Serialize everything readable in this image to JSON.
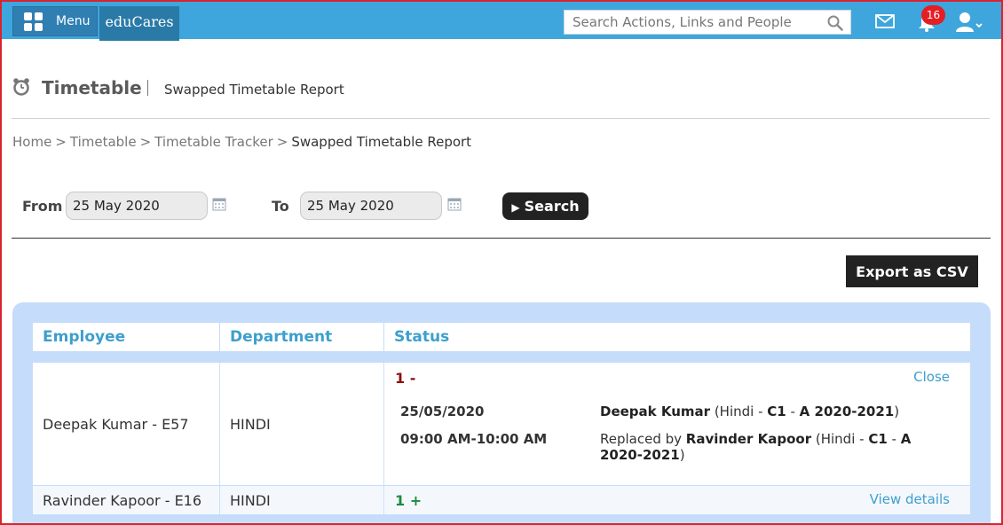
{
  "topbar": {
    "menu_label": "Menu",
    "brand": "eduCares",
    "search_placeholder": "Search Actions, Links and People",
    "notification_count": "16",
    "accent_color": "#3ea6dc"
  },
  "page": {
    "title": "Timetable",
    "subtitle": "Swapped Timetable Report"
  },
  "breadcrumb": [
    {
      "label": "Home"
    },
    {
      "label": "Timetable"
    },
    {
      "label": "Timetable Tracker"
    },
    {
      "label": "Swapped Timetable Report"
    }
  ],
  "filter": {
    "from_label": "From",
    "from_value": "25 May 2020",
    "to_label": "To",
    "to_value": "25 May 2020",
    "search_label": "Search"
  },
  "export_label": "Export as CSV",
  "table": {
    "headers": {
      "employee": "Employee",
      "department": "Department",
      "status": "Status"
    },
    "rows": [
      {
        "employee": "Deepak Kumar - E57",
        "department": "HINDI",
        "status_count": "1 -",
        "action": "Close",
        "detail": {
          "date": "25/05/2020",
          "time": "09:00 AM-10:00 AM",
          "teacher": "Deepak Kumar",
          "teacher_paren_open": " (Hindi - ",
          "class_code": "C1",
          "dash": " - ",
          "section_year": "A 2020-2021",
          "paren_close": ")",
          "replaced_prefix": "Replaced by ",
          "replacement": "Ravinder Kapoor",
          "replacement_paren_open": "  (Hindi - ",
          "r_class_code": "C1",
          "r_dash": " - ",
          "r_section": "A",
          "r_year": "2020-2021",
          "r_paren_close": ")"
        }
      },
      {
        "employee": "Ravinder Kapoor - E16",
        "department": "HINDI",
        "status_count": "1 +",
        "action": "View details"
      }
    ]
  }
}
